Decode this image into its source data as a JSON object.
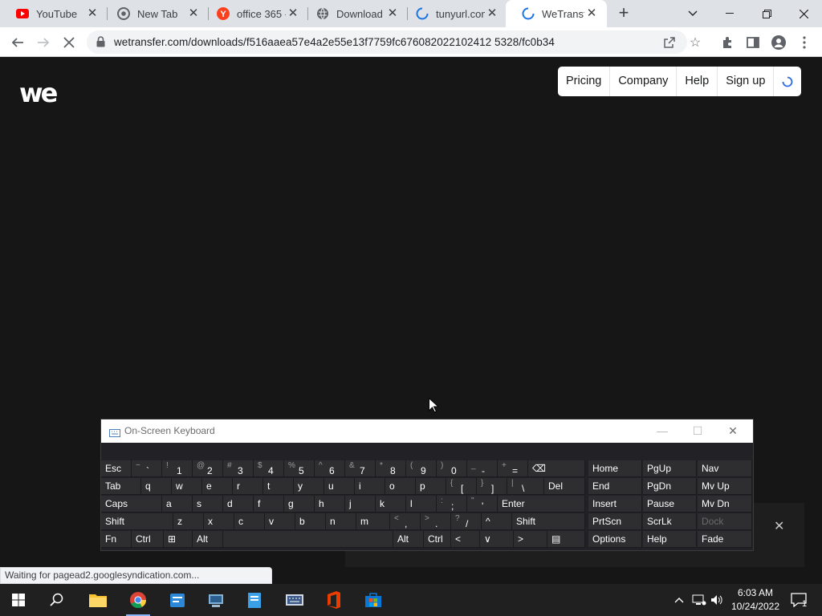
{
  "browser": {
    "tabs": [
      {
        "title": "YouTube",
        "icon": "youtube-icon"
      },
      {
        "title": "New Tab",
        "icon": "chrome-icon"
      },
      {
        "title": "office 365 -",
        "icon": "yandex-icon"
      },
      {
        "title": "Download",
        "icon": "globe-icon"
      },
      {
        "title": "tunyurl.com",
        "icon": "loading-icon"
      },
      {
        "title": "WeTransfer",
        "icon": "loading-icon"
      }
    ],
    "new_tab_label": "+",
    "url": "wetransfer.com/downloads/f516aaea57e4a2e55e13f7759fc676082022102412 5328/fc0b34",
    "status_text": "Waiting for pagead2.googlesyndication.com..."
  },
  "page": {
    "logo": "we",
    "nav": [
      "Pricing",
      "Company",
      "Help",
      "Sign up"
    ],
    "ad_close": "✕"
  },
  "osk": {
    "title": "On-Screen Keyboard",
    "rows": [
      [
        {
          "m": "Esc"
        },
        {
          "s": "~",
          "m": "`"
        },
        {
          "s": "!",
          "m": "1"
        },
        {
          "s": "@",
          "m": "2"
        },
        {
          "s": "#",
          "m": "3"
        },
        {
          "s": "$",
          "m": "4"
        },
        {
          "s": "%",
          "m": "5"
        },
        {
          "s": "^",
          "m": "6"
        },
        {
          "s": "&",
          "m": "7"
        },
        {
          "s": "*",
          "m": "8"
        },
        {
          "s": "(",
          "m": "9"
        },
        {
          "s": ")",
          "m": "0"
        },
        {
          "s": "_",
          "m": "-"
        },
        {
          "s": "+",
          "m": "="
        },
        {
          "m": "⌫"
        }
      ],
      [
        {
          "m": "Tab"
        },
        {
          "m": "q"
        },
        {
          "m": "w"
        },
        {
          "m": "e"
        },
        {
          "m": "r"
        },
        {
          "m": "t"
        },
        {
          "m": "y"
        },
        {
          "m": "u"
        },
        {
          "m": "i"
        },
        {
          "m": "o"
        },
        {
          "m": "p"
        },
        {
          "s": "{",
          "m": "["
        },
        {
          "s": "}",
          "m": "]"
        },
        {
          "s": "|",
          "m": "\\"
        },
        {
          "m": "Del"
        }
      ],
      [
        {
          "m": "Caps"
        },
        {
          "m": "a"
        },
        {
          "m": "s"
        },
        {
          "m": "d"
        },
        {
          "m": "f"
        },
        {
          "m": "g"
        },
        {
          "m": "h"
        },
        {
          "m": "j"
        },
        {
          "m": "k"
        },
        {
          "m": "l"
        },
        {
          "s": ":",
          "m": ";"
        },
        {
          "s": "\"",
          "m": "'"
        },
        {
          "m": "Enter"
        }
      ],
      [
        {
          "m": "Shift"
        },
        {
          "m": "z"
        },
        {
          "m": "x"
        },
        {
          "m": "c"
        },
        {
          "m": "v"
        },
        {
          "m": "b"
        },
        {
          "m": "n"
        },
        {
          "m": "m"
        },
        {
          "s": "<",
          "m": ","
        },
        {
          "s": ">",
          "m": "."
        },
        {
          "s": "?",
          "m": "/"
        },
        {
          "m": "^"
        },
        {
          "m": "Shift"
        }
      ],
      [
        {
          "m": "Fn"
        },
        {
          "m": "Ctrl"
        },
        {
          "m": "⊞"
        },
        {
          "m": "Alt"
        },
        {
          "m": ""
        },
        {
          "m": "Alt"
        },
        {
          "m": "Ctrl"
        },
        {
          "m": "<"
        },
        {
          "m": "∨"
        },
        {
          "m": ">"
        },
        {
          "m": "▤"
        }
      ]
    ],
    "nav_keys": [
      [
        "Home",
        "PgUp",
        "Nav"
      ],
      [
        "End",
        "PgDn",
        "Mv Up"
      ],
      [
        "Insert",
        "Pause",
        "Mv Dn"
      ],
      [
        "PrtScn",
        "ScrLk",
        "Dock"
      ],
      [
        "Options",
        "Help",
        "Fade"
      ]
    ]
  },
  "taskbar": {
    "apps": [
      "start-icon",
      "search-icon",
      "file-explorer-icon",
      "chrome-icon",
      "app-icon",
      "network-app-icon",
      "notes-app-icon",
      "keyboard-app-icon",
      "office-icon",
      "store-icon"
    ],
    "time": "6:03 AM",
    "date": "10/24/2022",
    "notifications": "1"
  }
}
